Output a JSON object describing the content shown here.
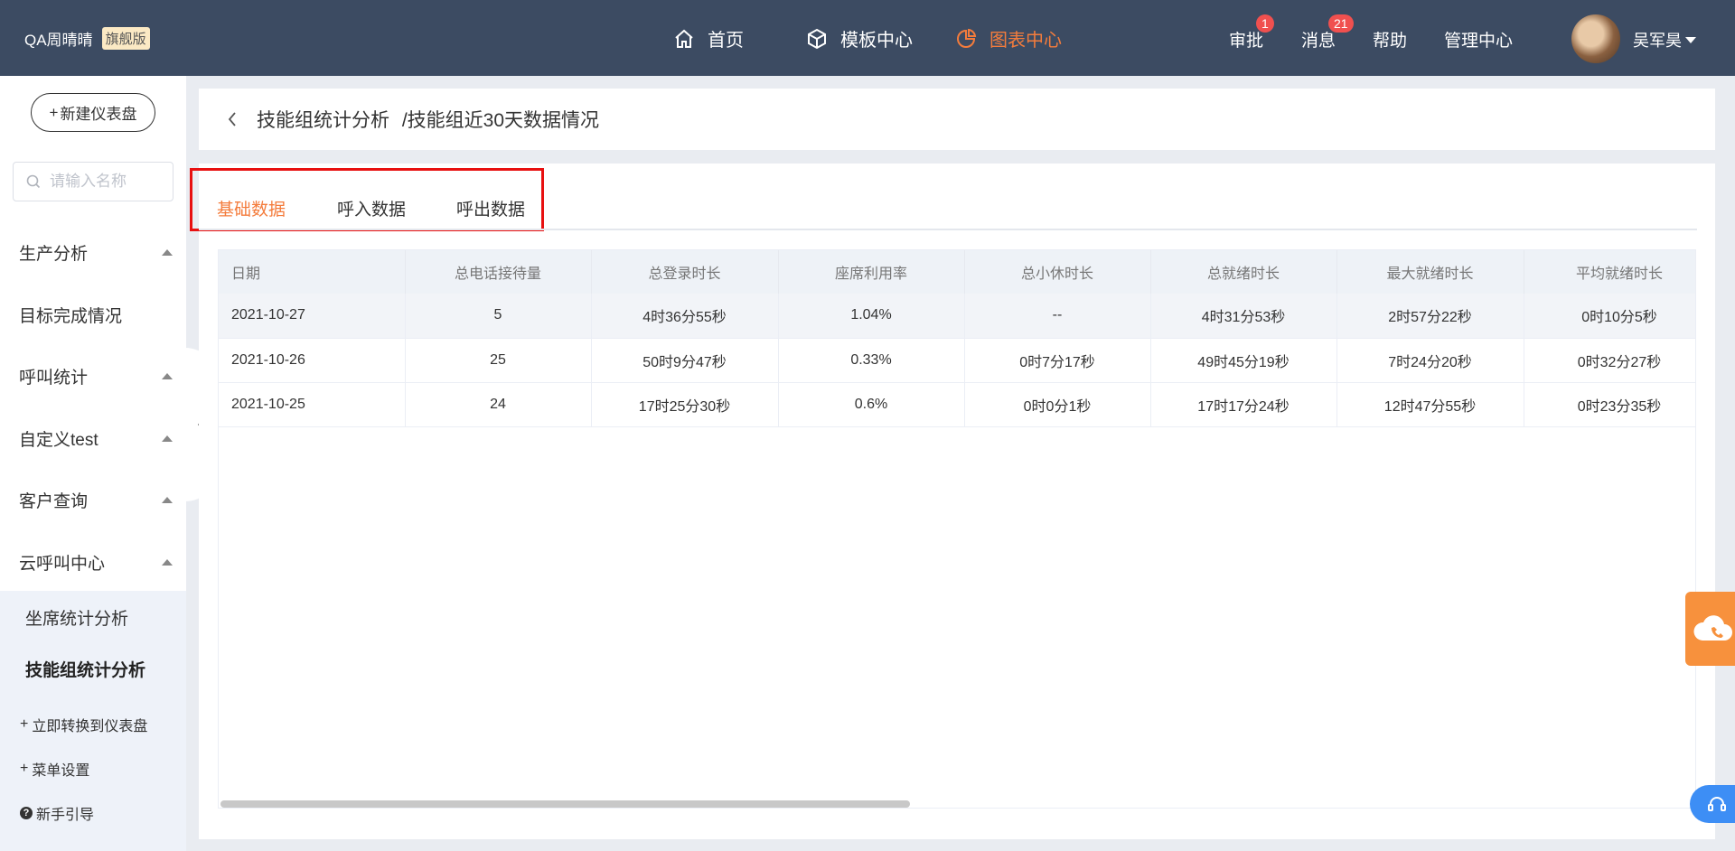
{
  "brand": {
    "name": "QA周晴晴",
    "badge": "旗舰版"
  },
  "nav": [
    {
      "label": "首页",
      "icon": "home-icon",
      "active": false
    },
    {
      "label": "模板中心",
      "icon": "cube-icon",
      "active": false
    },
    {
      "label": "图表中心",
      "icon": "pie-chart-icon",
      "active": true
    }
  ],
  "top_right": {
    "approve": {
      "label": "审批",
      "count": "1"
    },
    "messages": {
      "label": "消息",
      "count": "21"
    },
    "help": "帮助",
    "admin": "管理中心",
    "user": "吴军昊"
  },
  "sidebar": {
    "new_dashboard": "新建仪表盘",
    "search_placeholder": "请输入名称",
    "menu": [
      {
        "label": "生产分析",
        "expandable": true
      },
      {
        "label": "目标完成情况",
        "expandable": false
      },
      {
        "label": "呼叫统计",
        "expandable": true
      },
      {
        "label": "自定义test",
        "expandable": true
      },
      {
        "label": "客户查询",
        "expandable": true
      },
      {
        "label": "云呼叫中心",
        "expandable": true
      }
    ],
    "submenu": [
      {
        "label": "坐席统计分析",
        "active": false
      },
      {
        "label": "技能组统计分析",
        "active": true
      }
    ],
    "footer": {
      "convert": "立即转换到仪表盘",
      "menu_settings": "菜单设置",
      "guide": "新手引导"
    }
  },
  "header": {
    "title": "技能组统计分析",
    "subtitle": "/技能组近30天数据情况"
  },
  "tabs": [
    {
      "label": "基础数据",
      "active": true
    },
    {
      "label": "呼入数据",
      "active": false
    },
    {
      "label": "呼出数据",
      "active": false
    }
  ],
  "table": {
    "columns": [
      "日期",
      "总电话接待量",
      "总登录时长",
      "座席利用率",
      "总小休时长",
      "总就绪时长",
      "最大就绪时长",
      "平均就绪时长"
    ],
    "rows": [
      [
        "2021-10-27",
        "5",
        "4时36分55秒",
        "1.04%",
        "--",
        "4时31分53秒",
        "2时57分22秒",
        "0时10分5秒"
      ],
      [
        "2021-10-26",
        "25",
        "50时9分47秒",
        "0.33%",
        "0时7分17秒",
        "49时45分19秒",
        "7时24分20秒",
        "0时32分27秒"
      ],
      [
        "2021-10-25",
        "24",
        "17时25分30秒",
        "0.6%",
        "0时0分1秒",
        "17时17分24秒",
        "12时47分55秒",
        "0时23分35秒"
      ]
    ]
  },
  "colors": {
    "topbar": "#3c4b62",
    "accent": "#f47c3c",
    "highlight": "#e81010",
    "cloud_button": "#f7913d",
    "help_button": "#3d8ef5"
  }
}
